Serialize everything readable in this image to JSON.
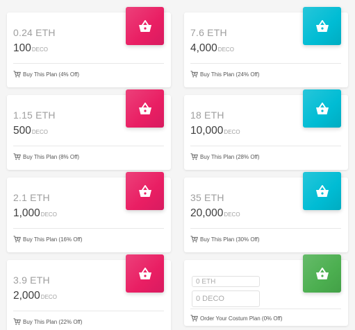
{
  "plans": [
    {
      "eth": "0.24 ETH",
      "deco_amount": "100",
      "deco_unit": "DECO",
      "label": "Buy This Plan (4% Off)",
      "color": "#e91e63"
    },
    {
      "eth": "7.6 ETH",
      "deco_amount": "4,000",
      "deco_unit": "DECO",
      "label": "Buy This Plan (24% Off)",
      "color": "#00bcd4"
    },
    {
      "eth": "1.15 ETH",
      "deco_amount": "500",
      "deco_unit": "DECO",
      "label": "Buy This Plan (8% Off)",
      "color": "#e91e63"
    },
    {
      "eth": "18 ETH",
      "deco_amount": "10,000",
      "deco_unit": "DECO",
      "label": "Buy This Plan (28% Off)",
      "color": "#00bcd4"
    },
    {
      "eth": "2.1 ETH",
      "deco_amount": "1,000",
      "deco_unit": "DECO",
      "label": "Buy This Plan (16% Off)",
      "color": "#e91e63"
    },
    {
      "eth": "35 ETH",
      "deco_amount": "20,000",
      "deco_unit": "DECO",
      "label": "Buy This Plan (30% Off)",
      "color": "#00bcd4"
    },
    {
      "eth": "3.9 ETH",
      "deco_amount": "2,000",
      "deco_unit": "DECO",
      "label": "Buy This Plan (22% Off)",
      "color": "#e91e63"
    }
  ],
  "custom_plan": {
    "eth_placeholder": "0 ETH",
    "deco_placeholder": "0 DECO",
    "label": "Order Your Costum Plan (0% Off)",
    "color": "#4caf50"
  },
  "icons": {
    "tile": "shopping-basket-icon",
    "footer": "add-to-cart-icon"
  }
}
